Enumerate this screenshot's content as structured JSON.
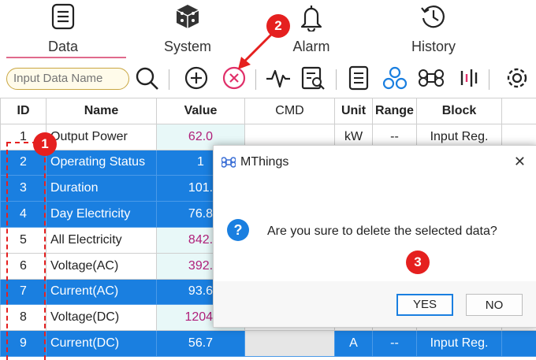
{
  "nav": {
    "tabs": [
      {
        "label": "Data",
        "icon": "list-icon"
      },
      {
        "label": "System",
        "icon": "cube-icon"
      },
      {
        "label": "Alarm",
        "icon": "bell-icon"
      },
      {
        "label": "History",
        "icon": "history-icon"
      }
    ]
  },
  "toolbar": {
    "search_placeholder": "Input Data Name"
  },
  "table": {
    "headers": [
      "ID",
      "Name",
      "Value",
      "CMD",
      "Unit",
      "Range",
      "Block"
    ],
    "rows": [
      {
        "id": "1",
        "name": "Output Power",
        "value": "62.0",
        "cmd": "",
        "unit": "kW",
        "range": "--",
        "block": "Input Reg."
      },
      {
        "id": "2",
        "name": "Operating Status",
        "value": "1",
        "cmd": "",
        "unit": "",
        "range": "",
        "block": ""
      },
      {
        "id": "3",
        "name": "Duration",
        "value": "101.",
        "cmd": "",
        "unit": "",
        "range": "",
        "block": ""
      },
      {
        "id": "4",
        "name": "Day Electricity",
        "value": "76.8",
        "cmd": "",
        "unit": "",
        "range": "",
        "block": ""
      },
      {
        "id": "5",
        "name": "All Electricity",
        "value": "842.",
        "cmd": "",
        "unit": "",
        "range": "",
        "block": ""
      },
      {
        "id": "6",
        "name": "Voltage(AC)",
        "value": "392.",
        "cmd": "",
        "unit": "",
        "range": "",
        "block": ""
      },
      {
        "id": "7",
        "name": "Current(AC)",
        "value": "93.6",
        "cmd": "",
        "unit": "",
        "range": "",
        "block": ""
      },
      {
        "id": "8",
        "name": "Voltage(DC)",
        "value": "1204.",
        "cmd": "",
        "unit": "",
        "range": "",
        "block": ""
      },
      {
        "id": "9",
        "name": "Current(DC)",
        "value": "56.7",
        "cmd": "",
        "unit": "A",
        "range": "--",
        "block": "Input Reg."
      }
    ]
  },
  "dialog": {
    "title": "MThings",
    "message": "Are you sure to delete the selected data?",
    "yes_label": "YES",
    "no_label": "NO",
    "close_glyph": "✕"
  },
  "callouts": {
    "one": "1",
    "two": "2",
    "three": "3"
  },
  "colors": {
    "selection": "#1a7fe0",
    "callout": "#e5201f",
    "value_text": "#b0207a"
  }
}
